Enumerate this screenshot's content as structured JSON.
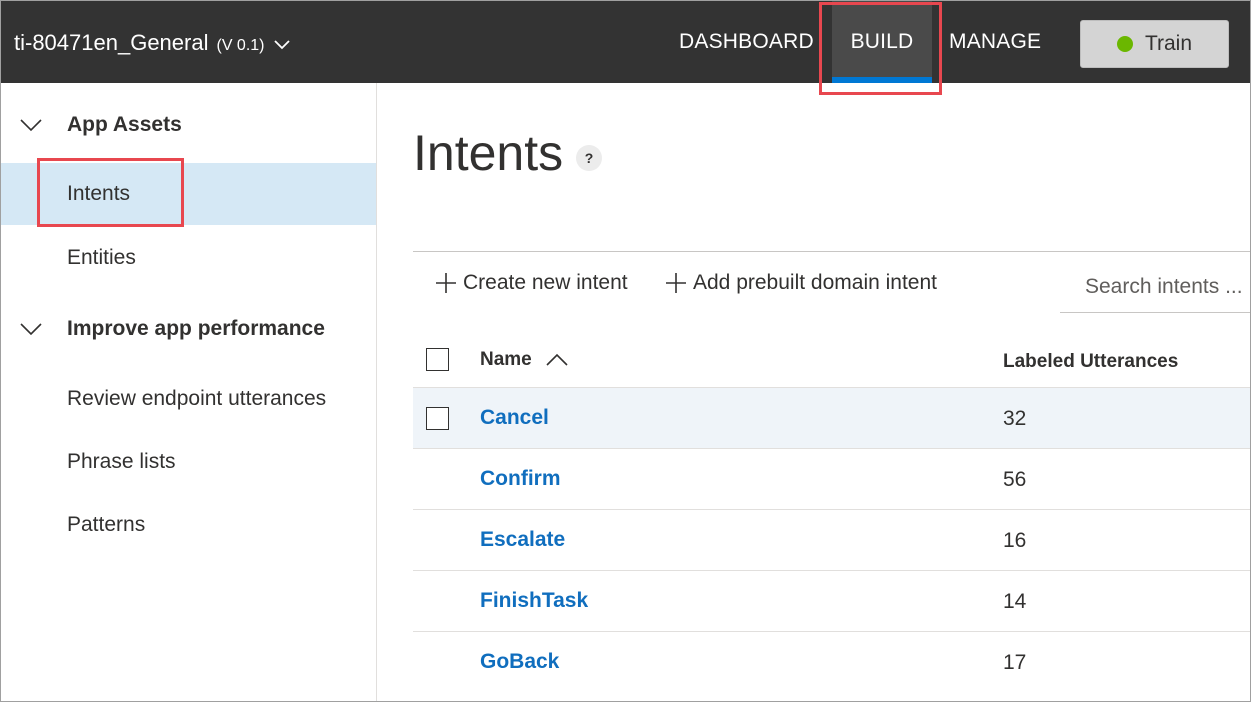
{
  "header": {
    "app_name": "ti-80471en_General",
    "version": "(V 0.1)",
    "nav": {
      "dashboard": "DASHBOARD",
      "build": "BUILD",
      "manage": "MANAGE"
    },
    "train_label": "Train",
    "train_status_color": "#6bb700"
  },
  "sidebar": {
    "app_assets": {
      "label": "App Assets",
      "items": [
        {
          "label": "Intents",
          "active": true
        },
        {
          "label": "Entities",
          "active": false
        }
      ]
    },
    "improve": {
      "label": "Improve app performance",
      "items": [
        {
          "label": "Review endpoint utterances"
        },
        {
          "label": "Phrase lists"
        },
        {
          "label": "Patterns"
        }
      ]
    }
  },
  "main": {
    "title": "Intents",
    "help_label": "?",
    "toolbar": {
      "create_label": "Create new intent",
      "prebuilt_label": "Add prebuilt domain intent",
      "search_placeholder": "Search intents ..."
    },
    "table": {
      "columns": {
        "name": "Name",
        "utterances": "Labeled Utterances"
      },
      "rows": [
        {
          "name": "Cancel",
          "count": "32"
        },
        {
          "name": "Confirm",
          "count": "56"
        },
        {
          "name": "Escalate",
          "count": "16"
        },
        {
          "name": "FinishTask",
          "count": "14"
        },
        {
          "name": "GoBack",
          "count": "17"
        }
      ]
    }
  },
  "colors": {
    "topbar": "#333333",
    "accent": "#0078d4",
    "link": "#106ebe",
    "highlight": "#e8474f",
    "sidebar_active": "#d5e8f5"
  }
}
